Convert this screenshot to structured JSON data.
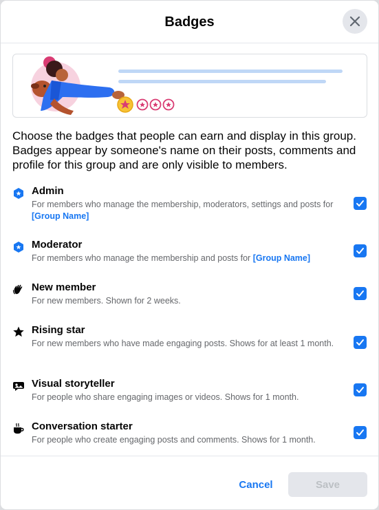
{
  "dialog": {
    "title": "Badges",
    "close_icon": "close-icon"
  },
  "banner": {
    "illustration": "person-with-dog-and-star-badges"
  },
  "description": "Choose the badges that people can earn and display in this group. Badges appear by someone's name on their posts, comments and profile for this group and are only visible to members.",
  "badges": [
    {
      "icon": "admin-shield-icon",
      "title": "Admin",
      "desc_prefix": "For members who manage the membership, moderators, settings and posts for ",
      "group_link": "[Group Name]",
      "checked": true
    },
    {
      "icon": "moderator-shield-icon",
      "title": "Moderator",
      "desc_prefix": "For members who manage the membership and posts for ",
      "group_link": "[Group Name]",
      "checked": true
    },
    {
      "icon": "waving-hand-icon",
      "title": "New member",
      "desc_prefix": "For new members. Shown for 2 weeks.",
      "group_link": "",
      "checked": true
    },
    {
      "icon": "star-icon",
      "title": "Rising star",
      "desc_prefix": "For new members who have made engaging posts. Shows for at least 1 month.",
      "group_link": "",
      "checked": true
    },
    {
      "icon": "image-chat-icon",
      "title": "Visual storyteller",
      "desc_prefix": "For people who share engaging images or videos. Shows for 1 month.",
      "group_link": "",
      "checked": true
    },
    {
      "icon": "coffee-cup-icon",
      "title": "Conversation starter",
      "desc_prefix": "For people who create engaging posts and comments. Shows for 1 month.",
      "group_link": "",
      "checked": true
    }
  ],
  "footer": {
    "cancel_label": "Cancel",
    "save_label": "Save"
  },
  "colors": {
    "accent": "#1877f2",
    "secondary_text": "#65676b",
    "disabled_bg": "#e4e6eb"
  }
}
